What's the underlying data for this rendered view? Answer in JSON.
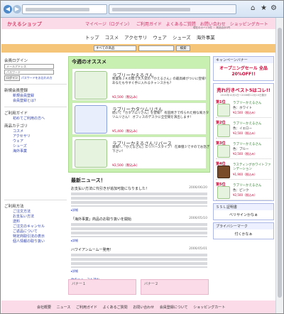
{
  "browser": {
    "back_icon": "back-arrow-icon",
    "forward_icon": "forward-arrow-icon",
    "back_glyph": "◀",
    "forward_glyph": "▶",
    "home_glyph": "⌂",
    "star_glyph": "★",
    "gear_glyph": "⚙"
  },
  "header": {
    "logo": "かえるショップ",
    "nav": [
      "マイページ（ログイン）",
      "ご利用ガイド",
      "よくあるご質問",
      "お問い合わせ",
      "ショッピングカート"
    ],
    "subtext": "現在のカート0件 ・ 商品合計0円",
    "categories": [
      "トップ",
      "コスメ",
      "アクセサリ",
      "ウェア",
      "シューズ",
      "海外事業"
    ]
  },
  "search": {
    "select_value": "すべての商品",
    "button": "検索"
  },
  "left": {
    "login_title": "会員ログイン",
    "email_placeholder": "メールアドレス",
    "password_placeholder": "パスワード",
    "login_button": "ログイン",
    "forgot": "パスワードをお忘れの方",
    "register_title": "新規会員登録",
    "register_links": [
      "新規会員登録",
      "会員登録とは？"
    ],
    "guide_title": "ご利用ガイド",
    "guide_links": [
      "初めてご利用の方へ"
    ],
    "category_title": "商品カテゴリ",
    "category_links": [
      "コスメ",
      "アクセサリ",
      "ウェア",
      "シューズ",
      "海外事業"
    ],
    "method_title": "ご利用方法",
    "method_links": [
      "ご注文方法",
      "お支払い方法",
      "送料",
      "ご注文のキャンセル",
      "ご返品について",
      "特定商取引法の表示",
      "個人情報の取り扱い"
    ]
  },
  "center": {
    "recommend_title": "今週のオススメ",
    "items": [
      {
        "name": "ラブリーかえるさん",
        "desc": "秋葉系ＪＫの間で大人気の「かえるさん」の最高峰がついに登場！ あなたも今すぐ手に入れるチャンスかも？",
        "price": "¥2,500（税込み）"
      },
      {
        "name": "ラブリーカタツムリさん",
        "desc": "続いて「カタツムリさん」を登場！ 有田焼きで作られた樹な風カタツムリさん！ オフィスのデスクに全空間を演出します！",
        "price": "¥5,400（税込み）"
      },
      {
        "name": "ラブリーかえるさんリバース",
        "desc": "速報!!、「かえるさん」にリバースタイプ！ 在庫僅少ですのでお急ぎ下さい！",
        "price": "¥2,500（税込み）"
      }
    ],
    "news_title": "最新ニュース！",
    "news": [
      {
        "head": "お支払い方法に代引きが追加可能になりました！",
        "date": "2006/06/20",
        "more": "▸詳細"
      },
      {
        "head": "「海外事業」商品のお取り扱いを開始",
        "date": "2006/05/10",
        "more": "▸詳細"
      },
      {
        "head": "ハワイアンムームー発売！",
        "date": "2006/05/01",
        "more": "▸詳細"
      }
    ],
    "news_more": "他のニュースも読む…",
    "banners": [
      "バナー１",
      "バナー２"
    ]
  },
  "right": {
    "campaign_title": "キャンペーンバナー",
    "campaign_text": "オープニングセール 全品20%OFF!!",
    "best_title": "売れ行きベスト5はコレ!!",
    "best_sub": "2015年12月1日〜2006年12月10日集計",
    "ranks": [
      {
        "no": "第1位",
        "name": "ラブリーかえるさん",
        "color": "色：ホワイト",
        "price": "¥2,500（税込み）",
        "alt": false
      },
      {
        "no": "第2位",
        "name": "ラブリーかえるさん",
        "color": "色：イエロー",
        "price": "¥2,500（税込み）",
        "alt": false
      },
      {
        "no": "第3位",
        "name": "ラブリーかえるさん",
        "color": "色：ブルー",
        "price": "¥2,500（税込み）",
        "alt": false
      },
      {
        "no": "第4位",
        "name": "ラスティングホワイトファンデーション",
        "color": "",
        "price": "¥1,900（税込み）",
        "alt": true
      },
      {
        "no": "第5位",
        "name": "ラブリーかえるさん",
        "color": "色：ピンク",
        "price": "¥2,500（税込み）",
        "alt": false
      }
    ],
    "ssl_title": "ＳＳＬ証明書",
    "ssl_text": "ベリサインかなぁ",
    "privacy_title": "プライバシーマーク",
    "privacy_text": "付くかなぁ"
  },
  "footer": {
    "links": [
      "会社概要",
      "ニュース",
      "ご利用ガイド",
      "よくあるご質問",
      "お問い合わせ",
      "会員登録について",
      "ショッピングカート"
    ]
  }
}
